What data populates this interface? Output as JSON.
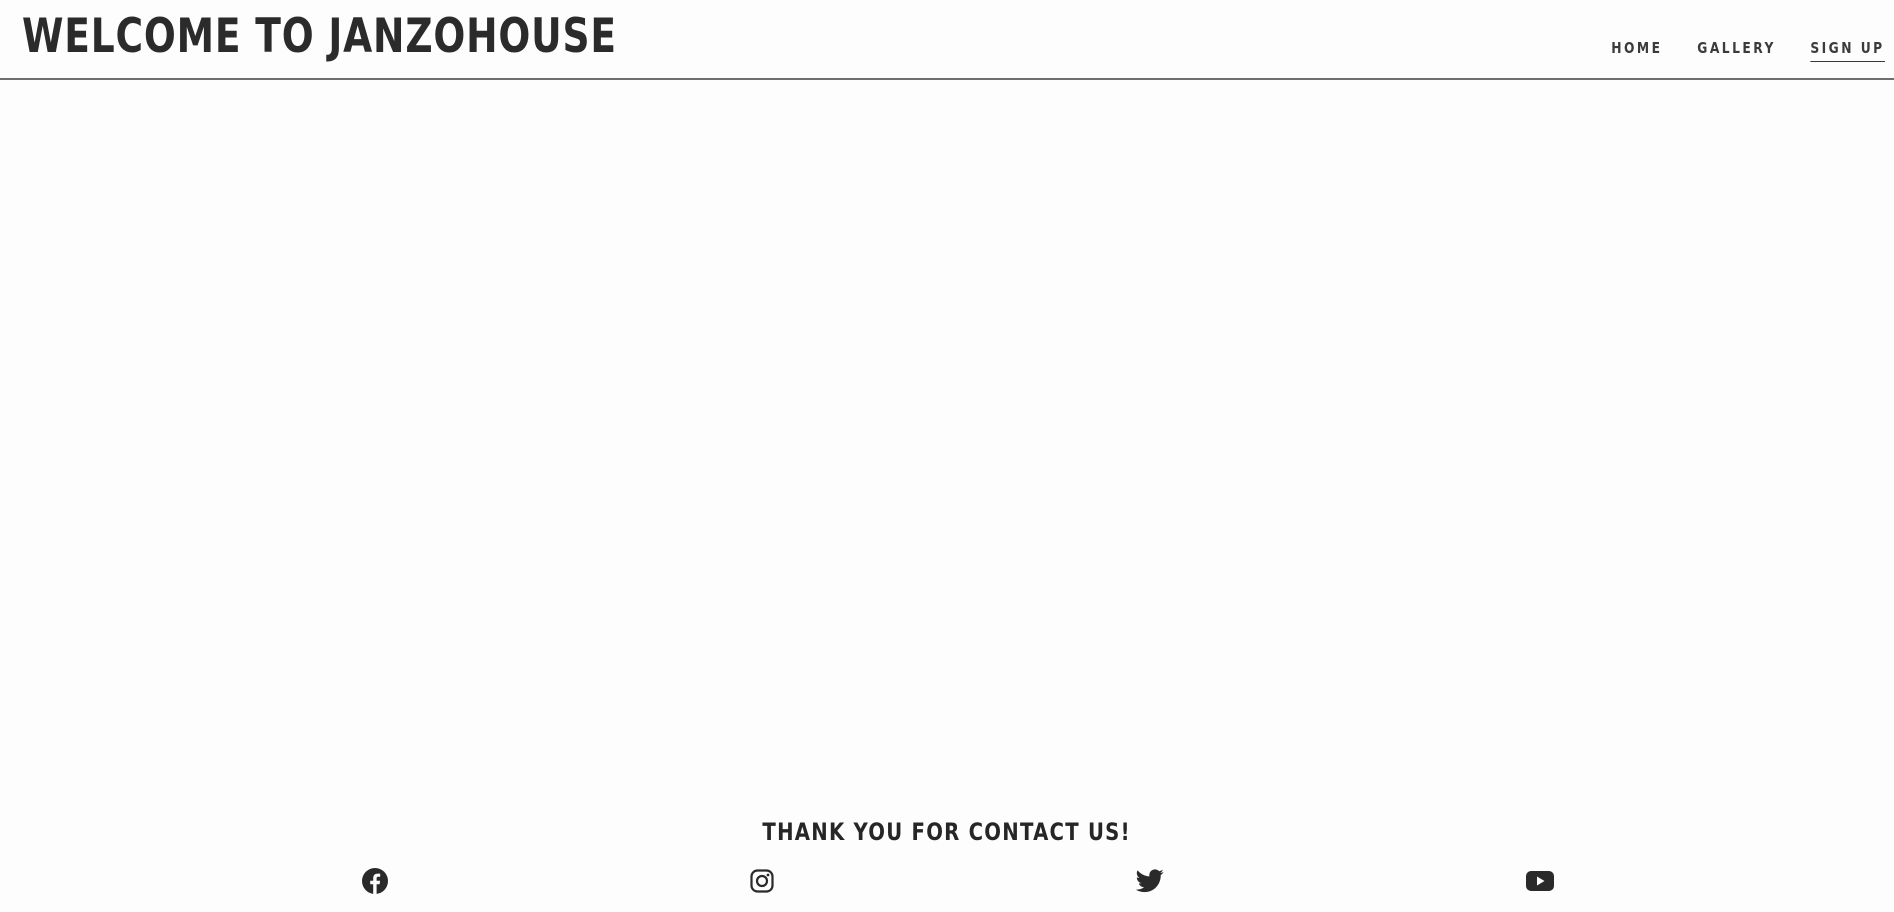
{
  "header": {
    "title": "WELCOME TO JANZOHOUSE",
    "nav": [
      {
        "label": "HOME",
        "active": false
      },
      {
        "label": "GALLERY",
        "active": false
      },
      {
        "label": "SIGN UP",
        "active": true
      }
    ]
  },
  "footer": {
    "heading": "THANK YOU FOR CONTACT US!",
    "social": [
      {
        "icon": "facebook-icon"
      },
      {
        "icon": "instagram-icon"
      },
      {
        "icon": "twitter-icon"
      },
      {
        "icon": "youtube-icon"
      }
    ]
  },
  "colors": {
    "background": "#fefdfd",
    "text": "#2a2a2a",
    "divider": "#6e6e6e"
  }
}
